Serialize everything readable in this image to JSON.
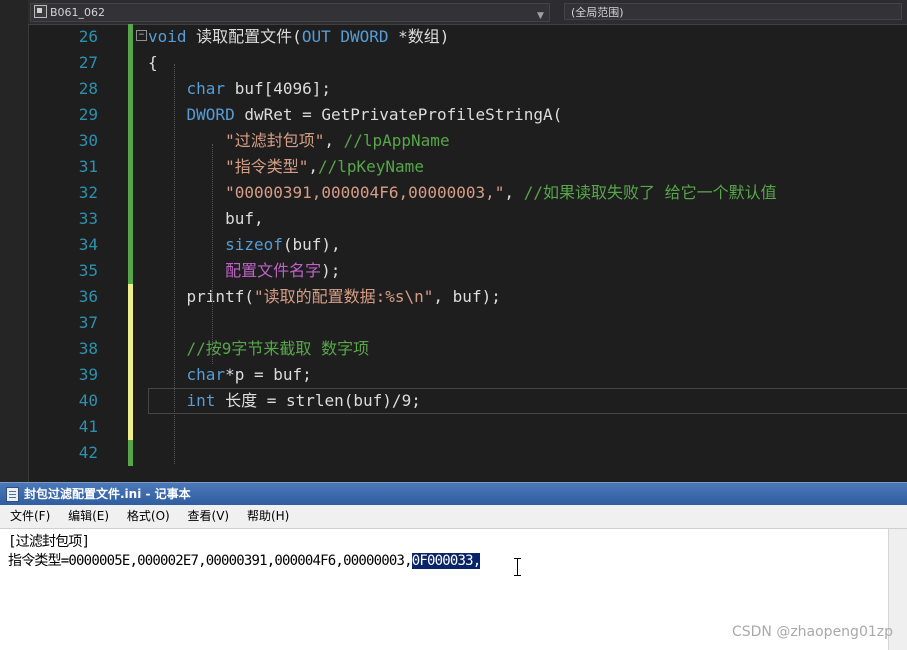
{
  "navbar": {
    "file_scope": "B061_062",
    "global_scope": "(全局范围)"
  },
  "code_lines": [
    {
      "num": "26",
      "segments": [
        {
          "t": "void",
          "c": "kw"
        },
        {
          "t": " 读取配置文件("
        },
        {
          "t": "OUT DWORD",
          "c": "kw"
        },
        {
          "t": " *数组)"
        }
      ]
    },
    {
      "num": "27",
      "segments": [
        {
          "t": "{"
        }
      ]
    },
    {
      "num": "28",
      "segments": [
        {
          "t": "    "
        },
        {
          "t": "char",
          "c": "kw"
        },
        {
          "t": " buf[4096];"
        }
      ]
    },
    {
      "num": "29",
      "segments": [
        {
          "t": "    "
        },
        {
          "t": "DWORD",
          "c": "kw"
        },
        {
          "t": " dwRet = GetPrivateProfileStringA("
        }
      ]
    },
    {
      "num": "30",
      "segments": [
        {
          "t": "        "
        },
        {
          "t": "\"过滤封包项\"",
          "c": "str"
        },
        {
          "t": ", "
        },
        {
          "t": "//lpAppName",
          "c": "cm"
        }
      ]
    },
    {
      "num": "31",
      "segments": [
        {
          "t": "        "
        },
        {
          "t": "\"指令类型\"",
          "c": "str"
        },
        {
          "t": ","
        },
        {
          "t": "//lpKeyName",
          "c": "cm"
        }
      ]
    },
    {
      "num": "32",
      "segments": [
        {
          "t": "        "
        },
        {
          "t": "\"00000391,000004F6,00000003,\"",
          "c": "str"
        },
        {
          "t": ", "
        },
        {
          "t": "//如果读取失败了 给它一个默认值",
          "c": "cm"
        }
      ]
    },
    {
      "num": "33",
      "segments": [
        {
          "t": "        buf,"
        }
      ]
    },
    {
      "num": "34",
      "segments": [
        {
          "t": "        "
        },
        {
          "t": "sizeof",
          "c": "kw"
        },
        {
          "t": "(buf),"
        }
      ]
    },
    {
      "num": "35",
      "segments": [
        {
          "t": "        "
        },
        {
          "t": "配置文件名字",
          "c": "macro"
        },
        {
          "t": ");"
        }
      ]
    },
    {
      "num": "36",
      "segments": [
        {
          "t": "    printf("
        },
        {
          "t": "\"读取的配置数据:%s\\n\"",
          "c": "str"
        },
        {
          "t": ", buf);"
        }
      ]
    },
    {
      "num": "37",
      "segments": []
    },
    {
      "num": "38",
      "segments": [
        {
          "t": "    "
        },
        {
          "t": "//按9字节来截取 数字项",
          "c": "cm"
        }
      ]
    },
    {
      "num": "39",
      "segments": [
        {
          "t": "    "
        },
        {
          "t": "char",
          "c": "kw"
        },
        {
          "t": "*p = buf;"
        }
      ]
    },
    {
      "num": "40",
      "segments": [
        {
          "t": "    "
        },
        {
          "t": "int",
          "c": "kw"
        },
        {
          "t": " 长度 = strlen(buf)/9;"
        }
      ]
    },
    {
      "num": "41",
      "segments": []
    },
    {
      "num": "42",
      "segments": []
    }
  ],
  "notepad": {
    "title": "封包过滤配置文件.ini - 记事本",
    "menu": [
      "文件(F)",
      "编辑(E)",
      "格式(O)",
      "查看(V)",
      "帮助(H)"
    ],
    "line1": "[过滤封包项]",
    "line2_prefix": "指令类型=0000005E,000002E7,00000391,000004F6,00000003,",
    "line2_selected": "0F000033,"
  },
  "watermark": "CSDN @zhaopeng01zp",
  "colors": {
    "keyword": "#569cd6",
    "string": "#d69d85",
    "comment": "#57a64a",
    "macro": "#bd63c5",
    "line_number": "#2b91af",
    "selection": "#0a246a"
  }
}
